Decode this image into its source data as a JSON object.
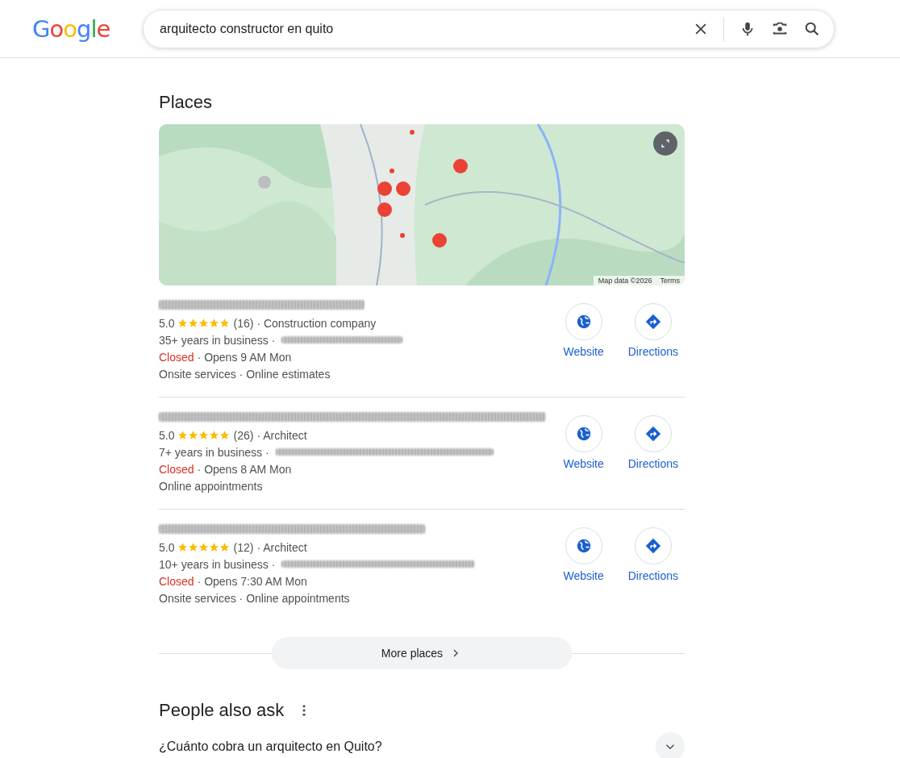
{
  "header": {
    "logo": "Google",
    "search": {
      "value": "arquitecto constructor en quito"
    }
  },
  "places": {
    "title": "Places",
    "map": {
      "kind": "picture",
      "attribution": "Map data ©2026",
      "terms": "Terms"
    },
    "listings": [
      {
        "rating": "5.0",
        "stars": 5,
        "reviews": "(16)",
        "category": "· Construction company",
        "years": "35+ years in business ·",
        "open": false,
        "status": "Closed",
        "hours": "· Opens 9 AM Mon",
        "features": "Onsite services · Online estimates",
        "actions": [
          "Website",
          "Directions"
        ]
      },
      {
        "rating": "5.0",
        "stars": 5,
        "reviews": "(26)",
        "category": "· Architect",
        "years": "7+ years in business ·",
        "open": false,
        "status": "Closed",
        "hours": "· Opens 8 AM Mon",
        "features": "Online appointments",
        "actions": [
          "Website",
          "Directions"
        ]
      },
      {
        "rating": "5.0",
        "stars": 5,
        "reviews": "(12)",
        "category": "· Architect",
        "years": "10+ years in business ·",
        "open": false,
        "status": "Closed",
        "hours": "· Opens 7:30 AM Mon",
        "features": "Onsite services · Online appointments",
        "actions": [
          "Website",
          "Directions"
        ]
      }
    ],
    "more": "More places"
  },
  "people_also_ask": {
    "title": "People also ask",
    "questions": [
      {
        "text": "¿Cuánto cobra un arquitecto en Quito?",
        "expanded": false
      }
    ]
  }
}
